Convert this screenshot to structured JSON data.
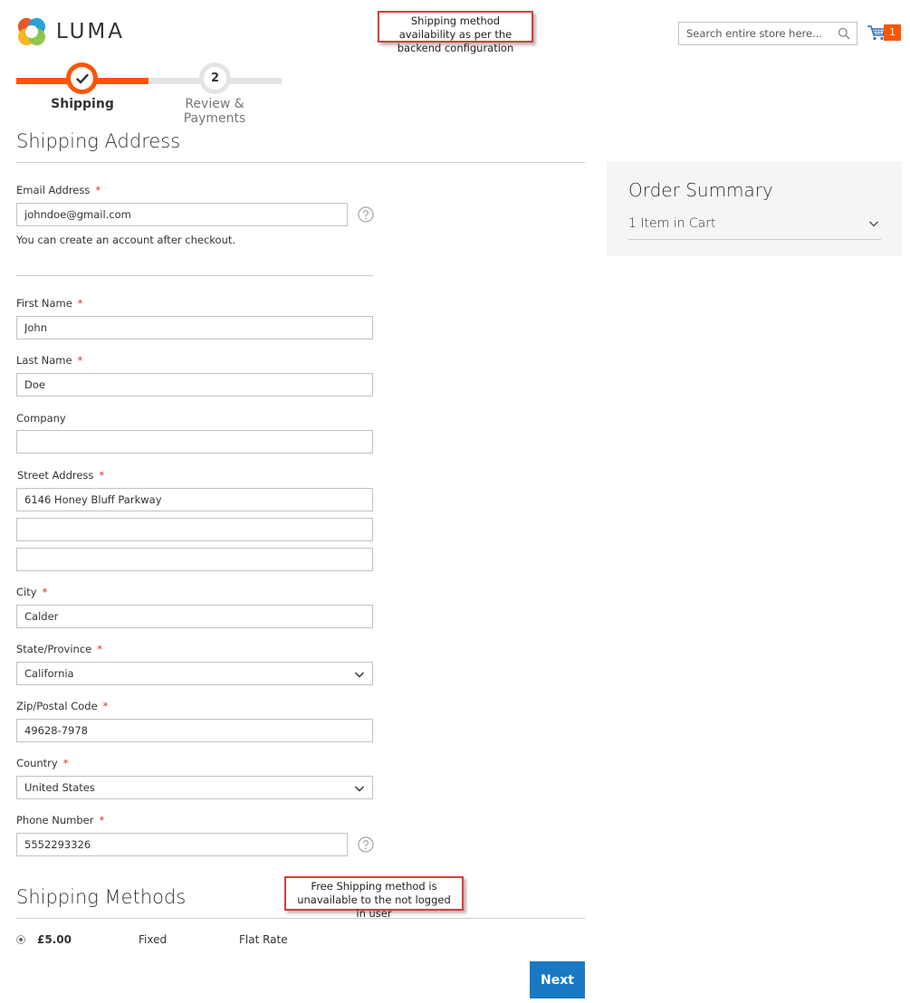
{
  "brand": {
    "name": "LUMA"
  },
  "annotations": {
    "top_callout": "Shipping method availability as per the backend configuration",
    "bottom_callout": "Free Shipping method is unavailable to the not logged in user"
  },
  "header": {
    "search_placeholder": "Search entire store here...",
    "cart_count": "1"
  },
  "steps": [
    {
      "number": "",
      "label": "Shipping",
      "state": "complete"
    },
    {
      "number": "2",
      "label": "Review & Payments",
      "state": "pending"
    }
  ],
  "shipping_address": {
    "title": "Shipping Address",
    "email": {
      "label": "Email Address",
      "value": "johndoe@gmail.com",
      "note": "You can create an account after checkout."
    },
    "first_name": {
      "label": "First Name",
      "value": "John"
    },
    "last_name": {
      "label": "Last Name",
      "value": "Doe"
    },
    "company": {
      "label": "Company",
      "value": ""
    },
    "street": {
      "label": "Street Address",
      "line1": "6146 Honey Bluff Parkway",
      "line2": "",
      "line3": ""
    },
    "city": {
      "label": "City",
      "value": "Calder"
    },
    "state": {
      "label": "State/Province",
      "value": "California"
    },
    "zip": {
      "label": "Zip/Postal Code",
      "value": "49628-7978"
    },
    "country": {
      "label": "Country",
      "value": "United States"
    },
    "phone": {
      "label": "Phone Number",
      "value": "5552293326"
    },
    "required_mark": "*"
  },
  "order_summary": {
    "title": "Order Summary",
    "items_in_cart": "1 Item in Cart"
  },
  "shipping_methods": {
    "title": "Shipping Methods",
    "options": [
      {
        "price": "£5.00",
        "method": "Fixed",
        "carrier": "Flat Rate",
        "selected": true
      }
    ]
  },
  "actions": {
    "next_label": "Next"
  },
  "colors": {
    "accent": "#ff5501",
    "primary_button": "#1979c3",
    "required": "#e02b27"
  }
}
